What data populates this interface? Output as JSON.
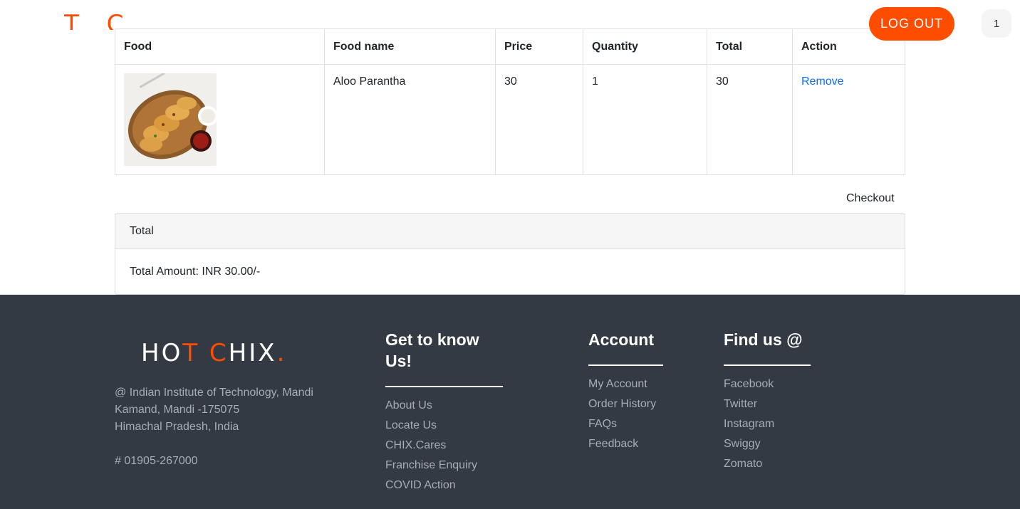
{
  "header": {
    "logo_text": "T C",
    "logo_dot": ".",
    "logout_label": "LOG OUT",
    "cart_count": "1"
  },
  "cart": {
    "columns": [
      "Food",
      "Food name",
      "Price",
      "Quantity",
      "Total",
      "Action"
    ],
    "rows": [
      {
        "food_name": "Aloo Parantha",
        "price": "30",
        "quantity": "1",
        "total": "30",
        "action": "Remove"
      }
    ],
    "checkout_label": "Checkout"
  },
  "summary": {
    "header": "Total",
    "amount_text": "Total Amount: INR 30.00/-"
  },
  "footer": {
    "logo_part1": "HO",
    "logo_part2": "T",
    "logo_part3": " ",
    "logo_part4": "C",
    "logo_part5": "HIX",
    "logo_dot": ".",
    "address_line1": "@ Indian Institute of Technology, Mandi",
    "address_line2": "Kamand, Mandi -175075",
    "address_line3": "Himachal Pradesh, India",
    "phone": "# 01905-267000",
    "col1": {
      "title": "Get to know Us!",
      "links": [
        "About Us",
        "Locate Us",
        "CHIX.Cares",
        "Franchise Enquiry",
        "COVID Action"
      ]
    },
    "col2": {
      "title": "Account",
      "links": [
        "My Account",
        "Order History",
        "FAQs",
        "Feedback"
      ]
    },
    "col3": {
      "title": "Find us @",
      "links": [
        "Facebook",
        "Twitter",
        "Instagram",
        "Swiggy",
        "Zomato"
      ]
    }
  },
  "colors": {
    "brand": "#ff4d00",
    "footer_bg": "#343a43",
    "link": "#0d6efd"
  }
}
